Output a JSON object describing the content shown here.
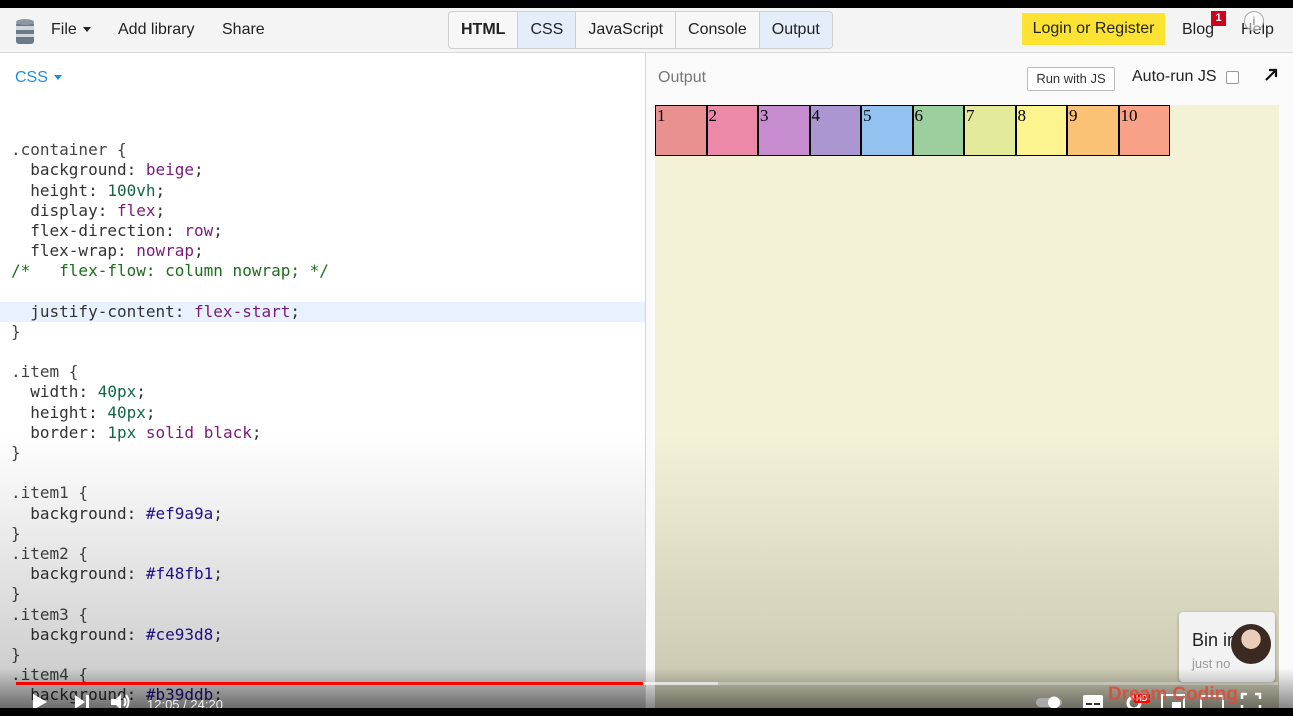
{
  "topbar": {
    "menu": {
      "file": "File",
      "add_library": "Add library",
      "share": "Share"
    },
    "tabs": [
      {
        "label": "HTML",
        "bold": true,
        "active": false
      },
      {
        "label": "CSS",
        "bold": false,
        "active": true
      },
      {
        "label": "JavaScript",
        "bold": false,
        "active": false
      },
      {
        "label": "Console",
        "bold": false,
        "active": false
      },
      {
        "label": "Output",
        "bold": false,
        "active": true
      }
    ],
    "login": "Login or Register",
    "blog": "Blog",
    "blog_badge": "1",
    "help": "Help",
    "info_glyph": "i"
  },
  "editor": {
    "panel_label": "CSS",
    "code_lines": [
      {
        "text": "",
        "hl": false
      },
      {
        "text": ".container {",
        "hl": false
      },
      {
        "text": "  background: beige;",
        "hl": false
      },
      {
        "text": "  height: 100vh;",
        "hl": false
      },
      {
        "text": "  display: flex;",
        "hl": false
      },
      {
        "text": "  flex-direction: row;",
        "hl": false
      },
      {
        "text": "  flex-wrap: nowrap;",
        "hl": false
      },
      {
        "text": "/*   flex-flow: column nowrap; */",
        "hl": false
      },
      {
        "text": "",
        "hl": false
      },
      {
        "text": "  justify-content: flex-start;",
        "hl": true
      },
      {
        "text": "}",
        "hl": false
      },
      {
        "text": "",
        "hl": false
      },
      {
        "text": ".item {",
        "hl": false
      },
      {
        "text": "  width: 40px;",
        "hl": false
      },
      {
        "text": "  height: 40px;",
        "hl": false
      },
      {
        "text": "  border: 1px solid black;",
        "hl": false
      },
      {
        "text": "}",
        "hl": false
      },
      {
        "text": "",
        "hl": false
      },
      {
        "text": ".item1 {",
        "hl": false
      },
      {
        "text": "  background: #ef9a9a;",
        "hl": false
      },
      {
        "text": "}",
        "hl": false
      },
      {
        "text": ".item2 {",
        "hl": false
      },
      {
        "text": "  background: #f48fb1;",
        "hl": false
      },
      {
        "text": "}",
        "hl": false
      },
      {
        "text": ".item3 {",
        "hl": false
      },
      {
        "text": "  background: #ce93d8;",
        "hl": false
      },
      {
        "text": "}",
        "hl": false
      },
      {
        "text": ".item4 {",
        "hl": false
      },
      {
        "text": "  background: #b39ddb;",
        "hl": false
      }
    ]
  },
  "output": {
    "label": "Output",
    "run_button": "Run with JS",
    "autorun_label": "Auto-run JS",
    "container_color": "#f3f1d6",
    "items": [
      {
        "label": "1",
        "color": "#e89190"
      },
      {
        "label": "2",
        "color": "#ed89a8"
      },
      {
        "label": "3",
        "color": "#c68ccf"
      },
      {
        "label": "4",
        "color": "#ab96d2"
      },
      {
        "label": "5",
        "color": "#93c1f0"
      },
      {
        "label": "6",
        "color": "#9cce9e"
      },
      {
        "label": "7",
        "color": "#e3ea9a"
      },
      {
        "label": "8",
        "color": "#fdf48f"
      },
      {
        "label": "9",
        "color": "#fbc175"
      },
      {
        "label": "10",
        "color": "#f8a187"
      }
    ]
  },
  "notification": {
    "name": "Bin in",
    "time": "just no"
  },
  "video": {
    "current_time": "12:05",
    "duration": "24:20",
    "progress_fraction": 0.4966,
    "buffered_fraction": 0.556,
    "brand": "Dream Coding",
    "hd_badge": "HD",
    "accent_color": "#ff0000"
  }
}
